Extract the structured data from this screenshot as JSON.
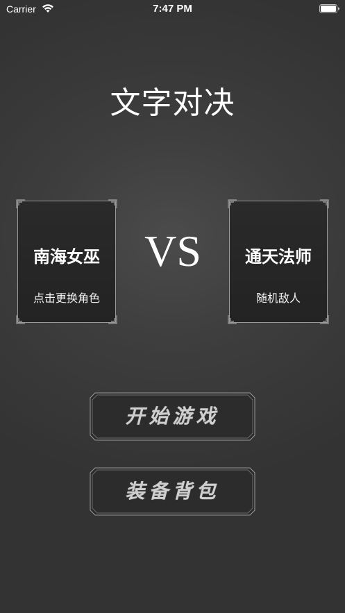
{
  "status_bar": {
    "carrier": "Carrier",
    "time": "7:47 PM",
    "wifi_icon": "wifi-icon",
    "battery_icon": "battery-icon"
  },
  "title": "文字对决",
  "player": {
    "name": "南海女巫",
    "hint": "点击更换角色"
  },
  "vs": "VS",
  "enemy": {
    "name": "通天法师",
    "hint": "随机敌人"
  },
  "buttons": {
    "start": "开始游戏",
    "bag": "装备背包"
  },
  "colors": {
    "background": "#3d3d3d",
    "card_background": "#262626",
    "card_border": "#9a9a9a",
    "button_background": "#2c2c2c",
    "button_text": "#cfcfcf",
    "text": "#ffffff"
  }
}
